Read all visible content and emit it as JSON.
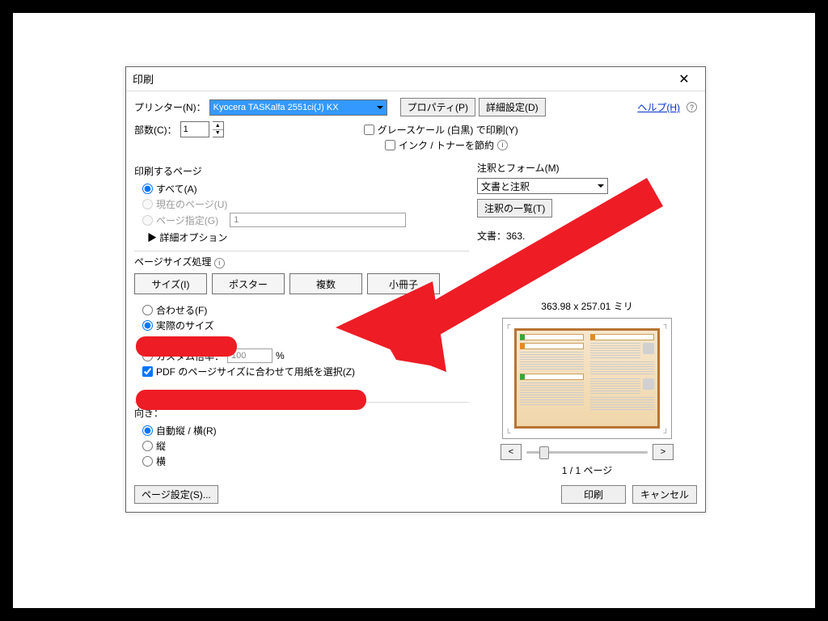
{
  "dialog": {
    "title": "印刷",
    "topRow": {
      "printerLabel": "プリンター(N)：",
      "printerValue": "Kyocera TASKalfa 2551ci(J) KX",
      "propertiesBtn": "プロパティ(P)",
      "advancedBtn": "詳細設定(D)",
      "helpLink": "ヘルプ(H)"
    },
    "copies": {
      "label": "部数(C)：",
      "value": "1"
    },
    "options": {
      "grayscale": "グレースケール (白黒) で印刷(Y)",
      "saveInk": "インク / トナーを節約"
    },
    "pages": {
      "title": "印刷するページ",
      "all": "すべて(A)",
      "current": "現在のページ(U)",
      "range": "ページ指定(G)",
      "rangeValue": "1",
      "more": "▶ 詳細オプション"
    },
    "sizing": {
      "title": "ページサイズ処理",
      "tabs": {
        "size": "サイズ(I)",
        "poster": "ポスター",
        "multi": "複数",
        "booklet": "小冊子"
      },
      "fit": "合わせる(F)",
      "actual": "実際のサイズ",
      "customScale": "カスタム倍率：",
      "scaleValue": "100",
      "scaleUnit": "%",
      "choosePaper": "PDF のページサイズに合わせて用紙を選択(Z)"
    },
    "orientation": {
      "title": "向き：",
      "auto": "自動縦 / 横(R)",
      "portrait": "縦",
      "landscape": "横"
    },
    "right": {
      "commentsTitle": "注釈とフォーム(M)",
      "commentsValue": "文書と注釈",
      "summaryBtn": "注釈の一覧(T)",
      "docLabelPrefix": "文書：363.",
      "docLabelSuffix": "mm",
      "previewCaption": "363.98 x 257.01 ミリ",
      "pageIndicator": "1 / 1 ページ"
    },
    "footer": {
      "pageSetup": "ページ設定(S)...",
      "print": "印刷",
      "cancel": "キャンセル"
    }
  }
}
